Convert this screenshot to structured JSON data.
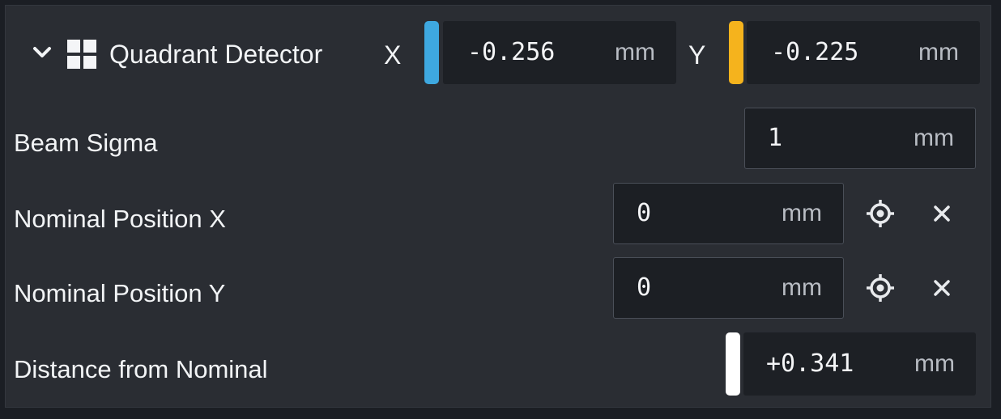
{
  "header": {
    "title": "Quadrant Detector",
    "x_label": "X",
    "x_value": "-0.256",
    "x_unit": "mm",
    "x_color": "#3ea8e0",
    "y_label": "Y",
    "y_value": "-0.225",
    "y_unit": "mm",
    "y_color": "#f5b31d"
  },
  "rows": {
    "beam_sigma": {
      "label": "Beam Sigma",
      "value": "1",
      "unit": "mm"
    },
    "nominal_x": {
      "label": "Nominal Position X",
      "value": "0",
      "unit": "mm"
    },
    "nominal_y": {
      "label": "Nominal Position Y",
      "value": "0",
      "unit": "mm"
    },
    "distance": {
      "label": "Distance from Nominal",
      "value": "+0.341",
      "unit": "mm",
      "indicator_color": "#ffffff"
    }
  },
  "icons": {
    "chevron": "chevron-down-icon",
    "detector": "quadrant-grid-icon",
    "target": "crosshair-icon",
    "clear": "close-icon"
  }
}
